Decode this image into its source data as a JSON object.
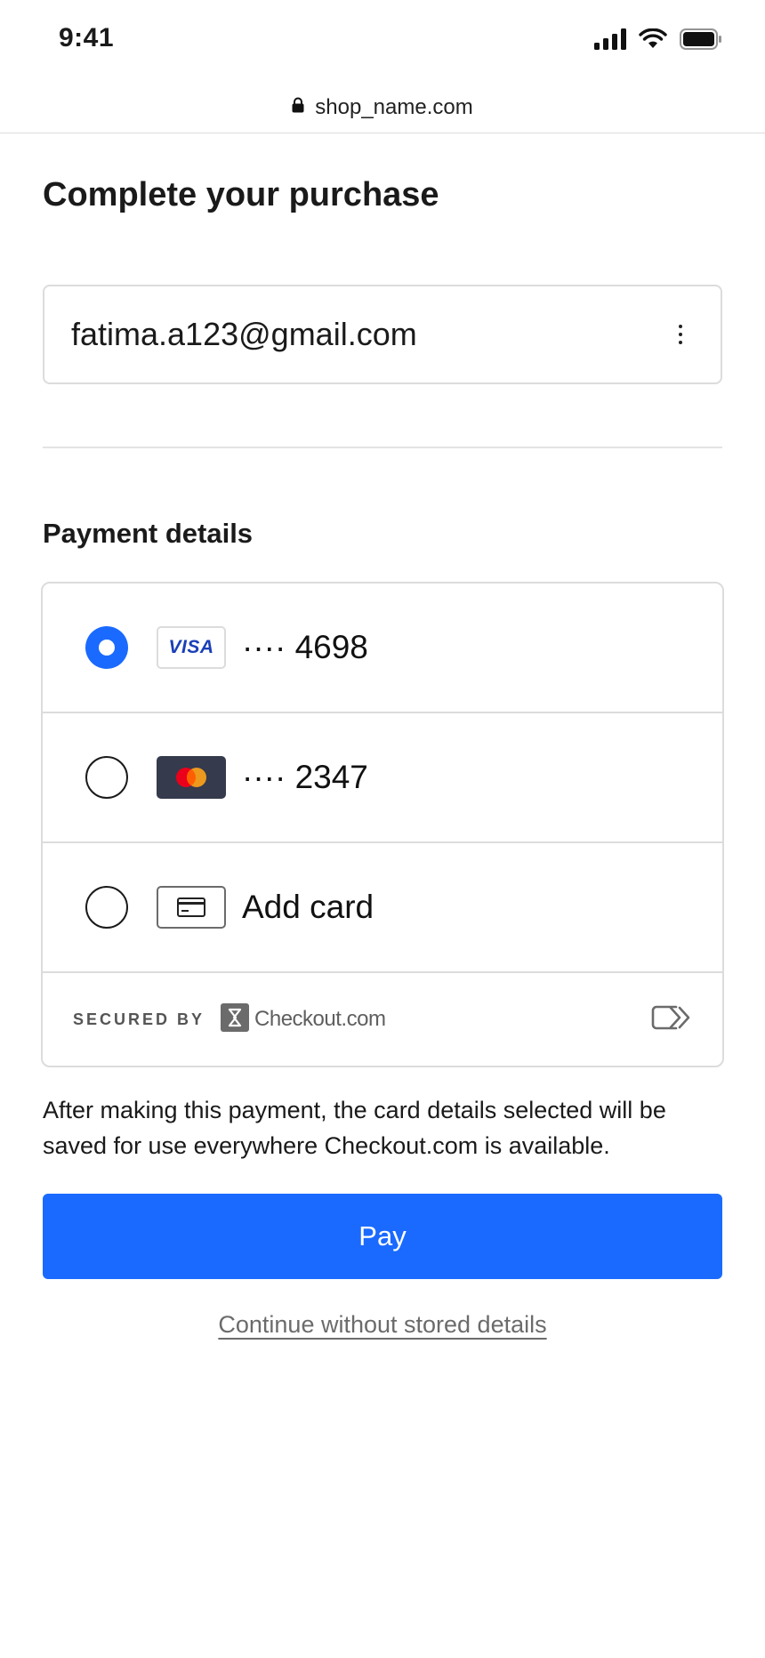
{
  "status_bar": {
    "time": "9:41",
    "icons": [
      "signal-icon",
      "wifi-icon",
      "battery-icon"
    ]
  },
  "browser": {
    "url": "shop_name.com",
    "icon": "lock-icon"
  },
  "page": {
    "title": "Complete your purchase"
  },
  "account": {
    "email": "fatima.a123@gmail.com",
    "menu_icon": "more-vertical-icon"
  },
  "payment": {
    "section_title": "Payment details",
    "options": [
      {
        "brand": "VISA",
        "masked": "···· 4698",
        "selected": true
      },
      {
        "brand": "mastercard",
        "masked": "···· 2347",
        "selected": false
      },
      {
        "brand": "card-icon",
        "label": "Add card",
        "selected": false
      }
    ],
    "secured_label": "SECURED BY",
    "secured_brand": "Checkout.com",
    "secured_right_icon": "checkout-pay-icon"
  },
  "notice": "After making this payment, the card details selected will be saved for use everywhere Checkout.com is available.",
  "pay_button": "Pay",
  "continue_link": "Continue without stored details",
  "colors": {
    "accent": "#1a6aff",
    "visa_blue": "#1a3fb8",
    "mastercard_bg": "#353a4c",
    "mastercard_red": "#eb001b",
    "mastercard_orange": "#f79e1b"
  }
}
